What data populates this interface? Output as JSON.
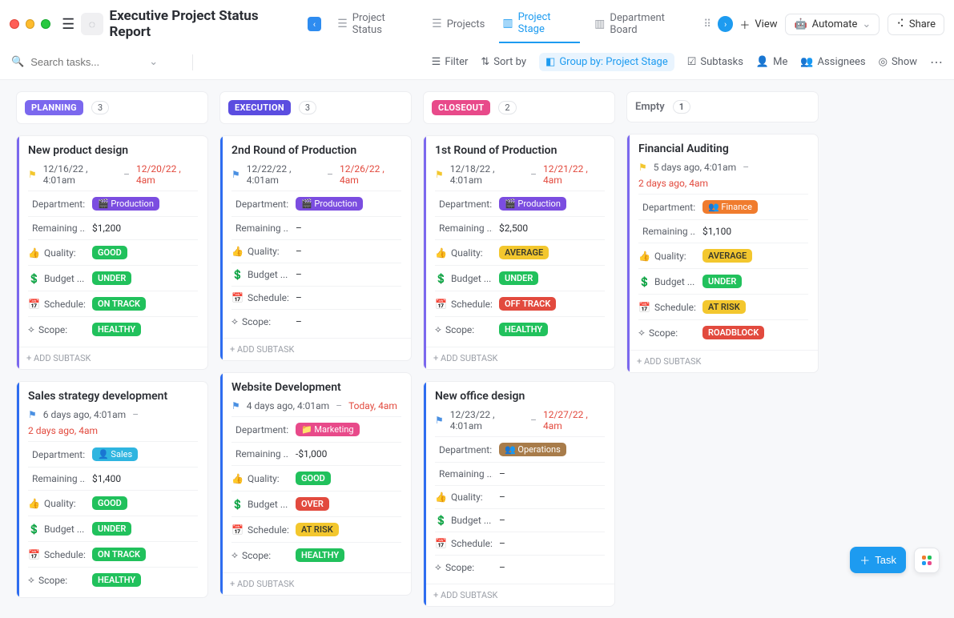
{
  "header": {
    "title": "Executive Project Status Report",
    "tabs": [
      {
        "label": "Project Status",
        "icon": "list"
      },
      {
        "label": "Projects",
        "icon": "list"
      },
      {
        "label": "Project Stage",
        "icon": "board",
        "active": true
      },
      {
        "label": "Department Board",
        "icon": "board"
      }
    ],
    "view_label": "View",
    "automate_label": "Automate",
    "share_label": "Share"
  },
  "toolbar": {
    "search_placeholder": "Search tasks...",
    "filter": "Filter",
    "sort": "Sort by",
    "group": "Group by: Project Stage",
    "subtasks": "Subtasks",
    "me": "Me",
    "assignees": "Assignees",
    "show": "Show"
  },
  "columns": [
    {
      "id": "planning",
      "label": "PLANNING",
      "count": "3",
      "class": "planning"
    },
    {
      "id": "execution",
      "label": "EXECUTION",
      "count": "3",
      "class": "execution"
    },
    {
      "id": "closeout",
      "label": "CLOSEOUT",
      "count": "2",
      "class": "closeout"
    },
    {
      "id": "empty",
      "label": "Empty",
      "count": "1",
      "empty": true
    }
  ],
  "deptClasses": {
    "Production": "dept-production",
    "Sales": "dept-sales",
    "Marketing": "dept-marketing",
    "Operations": "dept-operations",
    "Finance": "dept-finance"
  },
  "deptEmoji": {
    "Production": "🎬",
    "Sales": "👤",
    "Marketing": "📁",
    "Operations": "👥",
    "Finance": "👥"
  },
  "pillClasses": {
    "GOOD": "p-green",
    "AVERAGE": "p-yellow",
    "UNDER": "p-green",
    "OVER": "p-red",
    "ON TRACK": "p-green",
    "OFF TRACK": "p-red",
    "AT RISK": "p-yellow",
    "HEALTHY": "p-green",
    "ROADBLOCK": "p-red"
  },
  "flagColors": {
    "yellow": "#f3c72e",
    "blue": "#4a90e2"
  },
  "fieldLabels": {
    "department": "Department:",
    "remaining": "Remaining ...",
    "quality": "Quality:",
    "budget": "Budget ...",
    "schedule": "Schedule:",
    "scope": "Scope:"
  },
  "addSubtask": "+ ADD SUBTASK",
  "fab": {
    "task": "Task"
  },
  "cards": {
    "planning": [
      {
        "stripe": "purple",
        "title": "New product design",
        "flag": "yellow",
        "date1": "12/16/22 , 4:01am",
        "date2": "12/20/22 , 4am",
        "date2_red": true,
        "department": "Production",
        "remaining": "$1,200",
        "quality": "GOOD",
        "budget": "UNDER",
        "schedule": "ON TRACK",
        "scope": "HEALTHY"
      },
      {
        "stripe": "blue",
        "title": "Sales strategy development",
        "flag": "blue",
        "date1": "6 days ago, 4:01am",
        "date2_red_line": "2 days ago, 4am",
        "department": "Sales",
        "remaining": "$1,400",
        "quality": "GOOD",
        "budget": "UNDER",
        "schedule": "ON TRACK",
        "scope": "HEALTHY",
        "no_add": true
      }
    ],
    "execution": [
      {
        "stripe": "blue",
        "title": "2nd Round of Production",
        "flag": "blue",
        "date1": "12/22/22 , 4:01am",
        "date2": "12/26/22 , 4am",
        "date2_red": true,
        "department": "Production",
        "remaining": "–",
        "quality": "–",
        "budget": "–",
        "schedule": "–",
        "scope": "–"
      },
      {
        "stripe": "blue",
        "title": "Website Development",
        "flag": "blue",
        "date1": "4 days ago, 4:01am",
        "date2": "Today, 4am",
        "date2_red": true,
        "department": "Marketing",
        "remaining": "-$1,000",
        "quality": "GOOD",
        "budget": "OVER",
        "schedule": "AT RISK",
        "scope": "HEALTHY"
      }
    ],
    "closeout": [
      {
        "stripe": "purple",
        "title": "1st Round of Production",
        "flag": "yellow",
        "date1": "12/18/22 , 4:01am",
        "date2": "12/21/22 , 4am",
        "date2_red": true,
        "department": "Production",
        "remaining": "$2,500",
        "quality": "AVERAGE",
        "budget": "UNDER",
        "schedule": "OFF TRACK",
        "scope": "HEALTHY"
      },
      {
        "stripe": "blue",
        "title": "New office design",
        "flag": "blue",
        "date1": "12/23/22 , 4:01am",
        "date2": "12/27/22 , 4am",
        "date2_red": true,
        "department": "Operations",
        "remaining": "–",
        "quality": "–",
        "budget": "–",
        "schedule": "–",
        "scope": "–"
      }
    ],
    "empty": [
      {
        "stripe": "purple",
        "title": "Financial Auditing",
        "flag": "yellow",
        "date1": "5 days ago, 4:01am",
        "date2_red_line": "2 days ago, 4am",
        "department": "Finance",
        "remaining": "$1,100",
        "quality": "AVERAGE",
        "budget": "UNDER",
        "schedule": "AT RISK",
        "scope": "ROADBLOCK"
      }
    ]
  }
}
